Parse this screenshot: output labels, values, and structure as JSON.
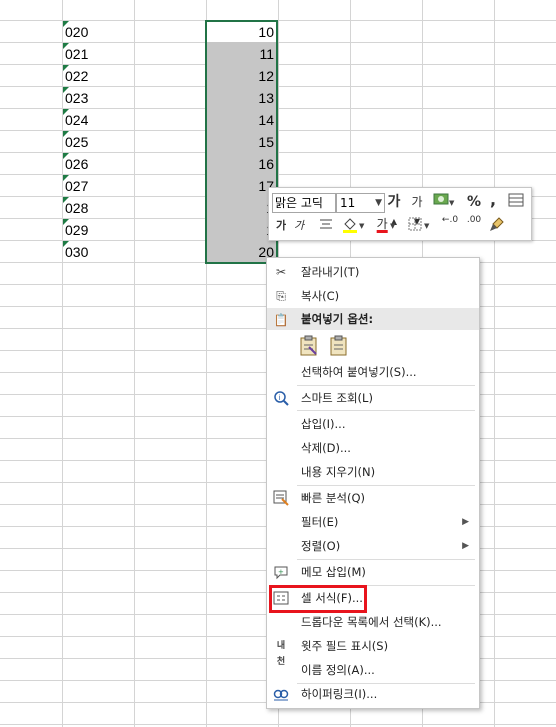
{
  "sheet": {
    "rows": [
      {
        "id": "020",
        "value": "10"
      },
      {
        "id": "021",
        "value": "11"
      },
      {
        "id": "022",
        "value": "12"
      },
      {
        "id": "023",
        "value": "13"
      },
      {
        "id": "024",
        "value": "14"
      },
      {
        "id": "025",
        "value": "15"
      },
      {
        "id": "026",
        "value": "16"
      },
      {
        "id": "027",
        "value": "17"
      },
      {
        "id": "028",
        "value": "1"
      },
      {
        "id": "029",
        "value": "1"
      },
      {
        "id": "030",
        "value": "20"
      }
    ]
  },
  "mini_toolbar": {
    "font_name": "맑은 고딕",
    "font_size": "11",
    "grow_font": "가",
    "shrink_font": "가",
    "percent": "%",
    "comma": ",",
    "bold": "가",
    "italic": "가",
    "font_color_glyph": "가",
    "decrease_decimal": "←.0",
    "increase_decimal": ".00"
  },
  "context_menu": {
    "cut": "잘라내기(T)",
    "copy": "복사(C)",
    "paste_options_header": "붙여넣기 옵션:",
    "paste_special": "선택하여 붙여넣기(S)...",
    "smart_lookup": "스마트 조회(L)",
    "insert": "삽입(I)...",
    "delete": "삭제(D)...",
    "clear_contents": "내용 지우기(N)",
    "quick_analysis": "빠른 분석(Q)",
    "filter": "필터(E)",
    "sort": "정렬(O)",
    "insert_comment": "메모 삽입(M)",
    "format_cells": "셀 서식(F)...",
    "pick_from_dropdown": "드롭다운 목록에서 선택(K)...",
    "phonetic": "윗주 필드 표시(S)",
    "define_name": "이름 정의(A)...",
    "hyperlink": "하이퍼링크(I)..."
  },
  "icons": {
    "cut": "scissors-icon",
    "copy": "copy-icon",
    "paste": "clipboard-icon",
    "smart_lookup": "info-search-icon",
    "quick_analysis": "quick-analysis-icon",
    "comment": "comment-icon",
    "format_cells": "format-cells-icon",
    "phonetic": "phonetic-icon",
    "hyperlink": "link-icon"
  },
  "colors": {
    "selection_border": "#217346",
    "selection_fill": "#c6c6c6",
    "highlight": "#e8141d",
    "font_color": "#e8141d",
    "fill_color": "#ffff00"
  }
}
